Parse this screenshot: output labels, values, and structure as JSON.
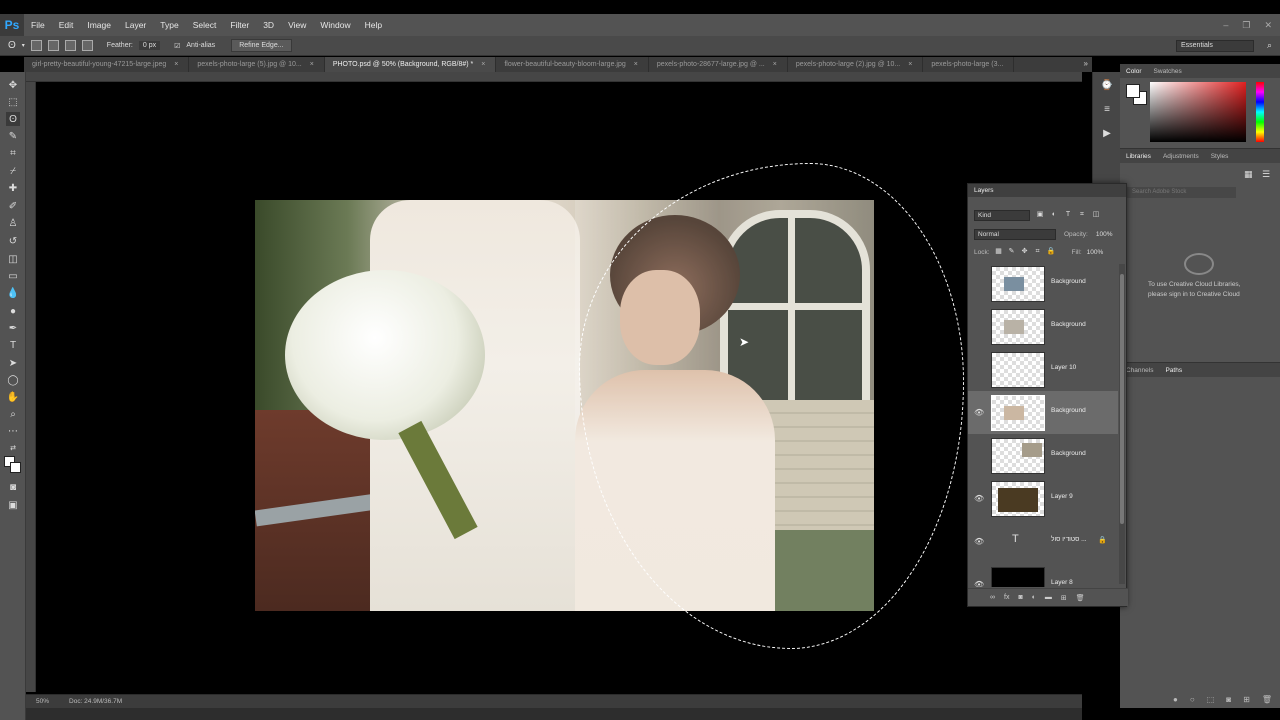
{
  "app": {
    "logo": "Ps"
  },
  "menu": [
    "File",
    "Edit",
    "Image",
    "Layer",
    "Type",
    "Select",
    "Filter",
    "3D",
    "View",
    "Window",
    "Help"
  ],
  "window_controls": {
    "minimize": "–",
    "restore": "❐",
    "close": "✕"
  },
  "options": {
    "feather_label": "Feather:",
    "feather_value": "0 px",
    "antialias_label": "Anti-alias",
    "refine_label": "Refine Edge...",
    "workspace": "Essentials"
  },
  "tabs": [
    {
      "label": "girl-pretty-beautiful-young-47215-large.jpeg",
      "active": false
    },
    {
      "label": "pexels-photo-large (5).jpg @ 10...",
      "active": false
    },
    {
      "label": "PHOTO.psd @ 50% (Background, RGB/8#) *",
      "active": true
    },
    {
      "label": "flower-beautiful-beauty-bloom-large.jpg",
      "active": false
    },
    {
      "label": "pexels-photo-28677-large.jpg @ ...",
      "active": false
    },
    {
      "label": "pexels-photo-large (2).jpg @ 10...",
      "active": false
    },
    {
      "label": "pexels-photo-large (3...",
      "active": false
    }
  ],
  "tab_close": "×",
  "status": {
    "zoom": "50%",
    "doc": "Doc: 24.9M/36.7M"
  },
  "color_panel": {
    "tabs": [
      "Color",
      "Swatches"
    ]
  },
  "library_panel": {
    "tabs": [
      "Libraries",
      "Adjustments",
      "Styles"
    ],
    "search_placeholder": "Search Adobe Stock",
    "message": "To use Creative Cloud Libraries, please sign in to Creative Cloud"
  },
  "paths_panel": {
    "tabs": [
      "Channels",
      "Paths"
    ]
  },
  "layers_panel": {
    "title": "Layers",
    "filter_kind": "Kind",
    "blend_mode": "Normal",
    "opacity_label": "Opacity:",
    "opacity_value": "100%",
    "lock_label": "Lock:",
    "fill_label": "Fill:",
    "fill_value": "100%",
    "layers": [
      {
        "name": "Background",
        "visible": false,
        "active": false,
        "kind": "image"
      },
      {
        "name": "Background",
        "visible": false,
        "active": false,
        "kind": "image"
      },
      {
        "name": "Layer 10",
        "visible": false,
        "active": false,
        "kind": "empty"
      },
      {
        "name": "Background",
        "visible": true,
        "active": true,
        "kind": "image"
      },
      {
        "name": "Background",
        "visible": false,
        "active": false,
        "kind": "image"
      },
      {
        "name": "Layer 9",
        "visible": true,
        "active": false,
        "kind": "photo"
      },
      {
        "name": "סטודיו סול ...",
        "visible": true,
        "active": false,
        "kind": "text"
      },
      {
        "name": "Layer 8",
        "visible": true,
        "active": false,
        "kind": "dark"
      }
    ]
  }
}
